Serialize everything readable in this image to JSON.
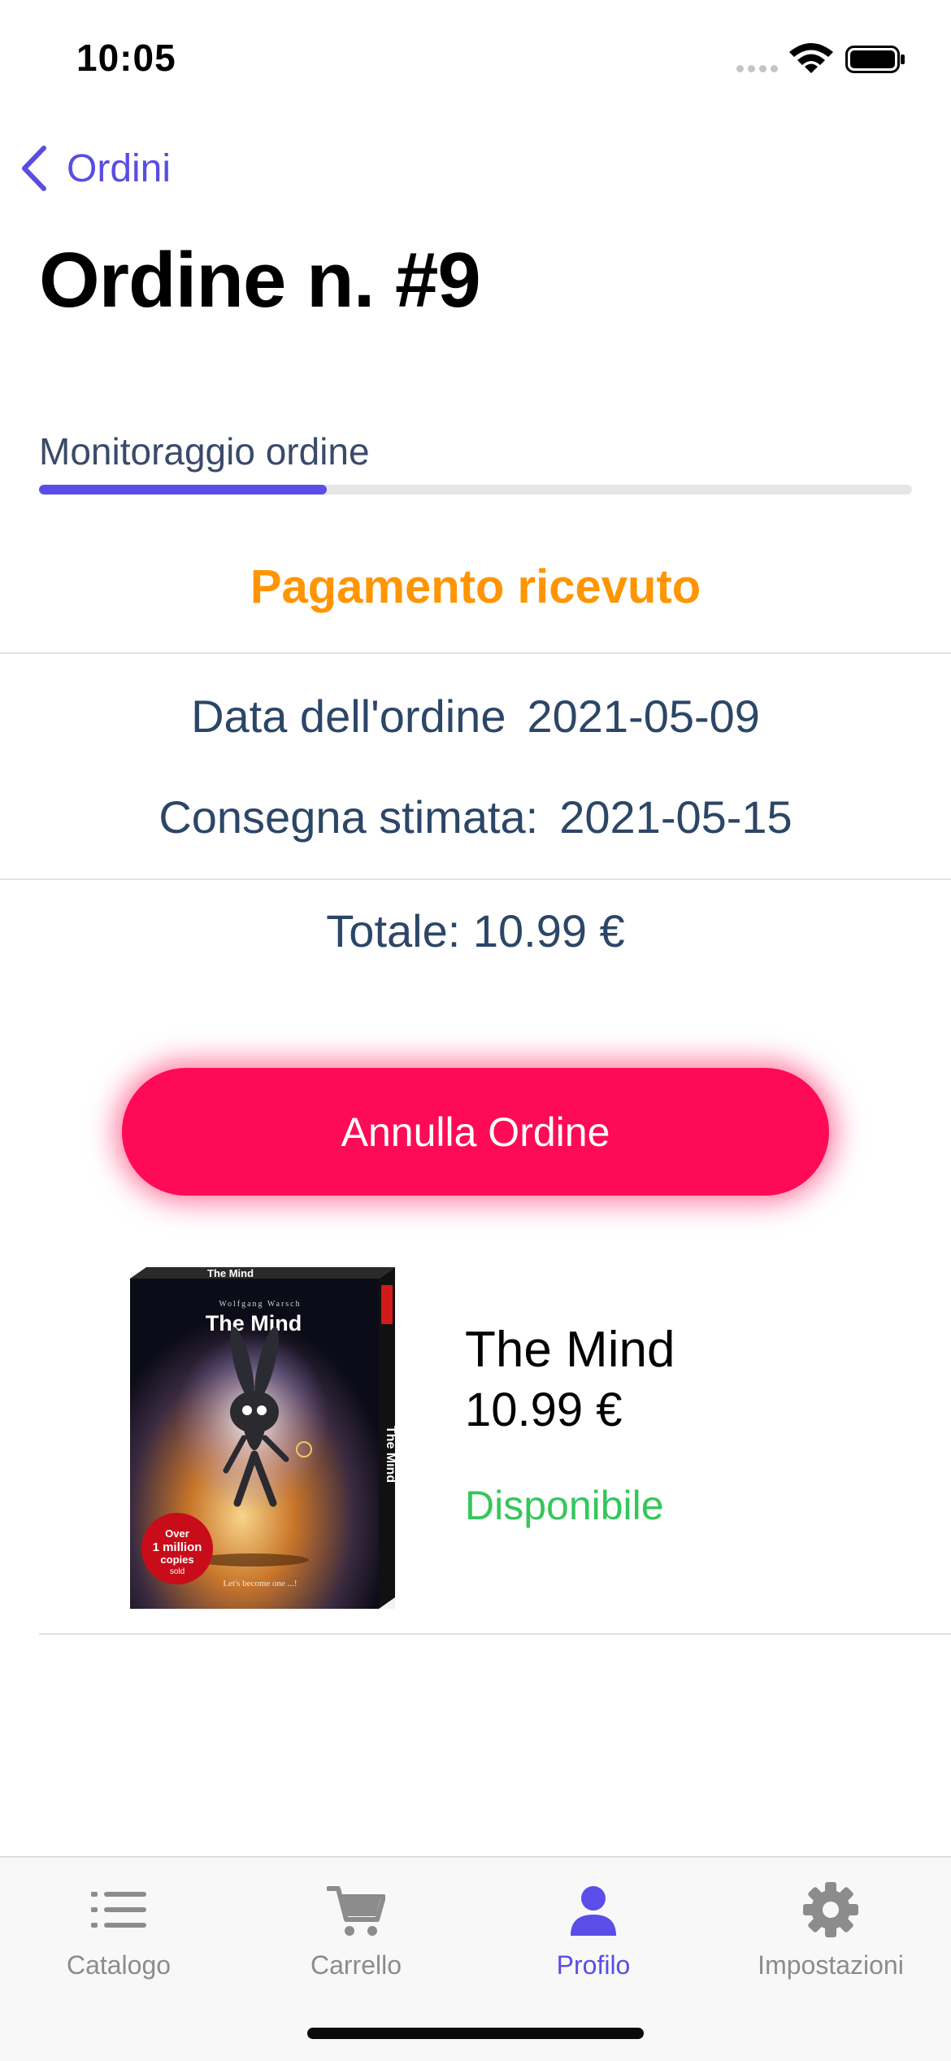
{
  "status_bar": {
    "time": "10:05"
  },
  "nav": {
    "back_label": "Ordini",
    "title": "Ordine n. #9"
  },
  "tracking": {
    "label": "Monitoraggio ordine",
    "progress": 0.33,
    "status": "Pagamento ricevuto",
    "status_color": "#ff9500"
  },
  "order": {
    "date_label": "Data dell'ordine",
    "date_value": "2021-05-09",
    "delivery_label": "Consegna stimata:",
    "delivery_value": "2021-05-15",
    "total": "Totale: 10.99 €"
  },
  "actions": {
    "cancel_label": "Annulla Ordine",
    "cancel_color": "#ff0a56"
  },
  "product": {
    "name": "The Mind",
    "price": "10.99 €",
    "availability": "Disponibile",
    "availability_color": "#34c759",
    "box_text": {
      "top": "The Mind",
      "author": "Wolfgang Warsch",
      "title": "The Mind",
      "badge_1": "Over",
      "badge_2": "1 million",
      "badge_3": "copies",
      "badge_4": "sold",
      "tagline": "Let's become one ...!",
      "spine": "The Mind"
    }
  },
  "tabbar": {
    "accent": "#5a4de8",
    "items": [
      {
        "label": "Catalogo",
        "icon": "list-icon"
      },
      {
        "label": "Carrello",
        "icon": "cart-icon"
      },
      {
        "label": "Profilo",
        "icon": "person-icon"
      },
      {
        "label": "Impostazioni",
        "icon": "gear-icon"
      }
    ]
  }
}
